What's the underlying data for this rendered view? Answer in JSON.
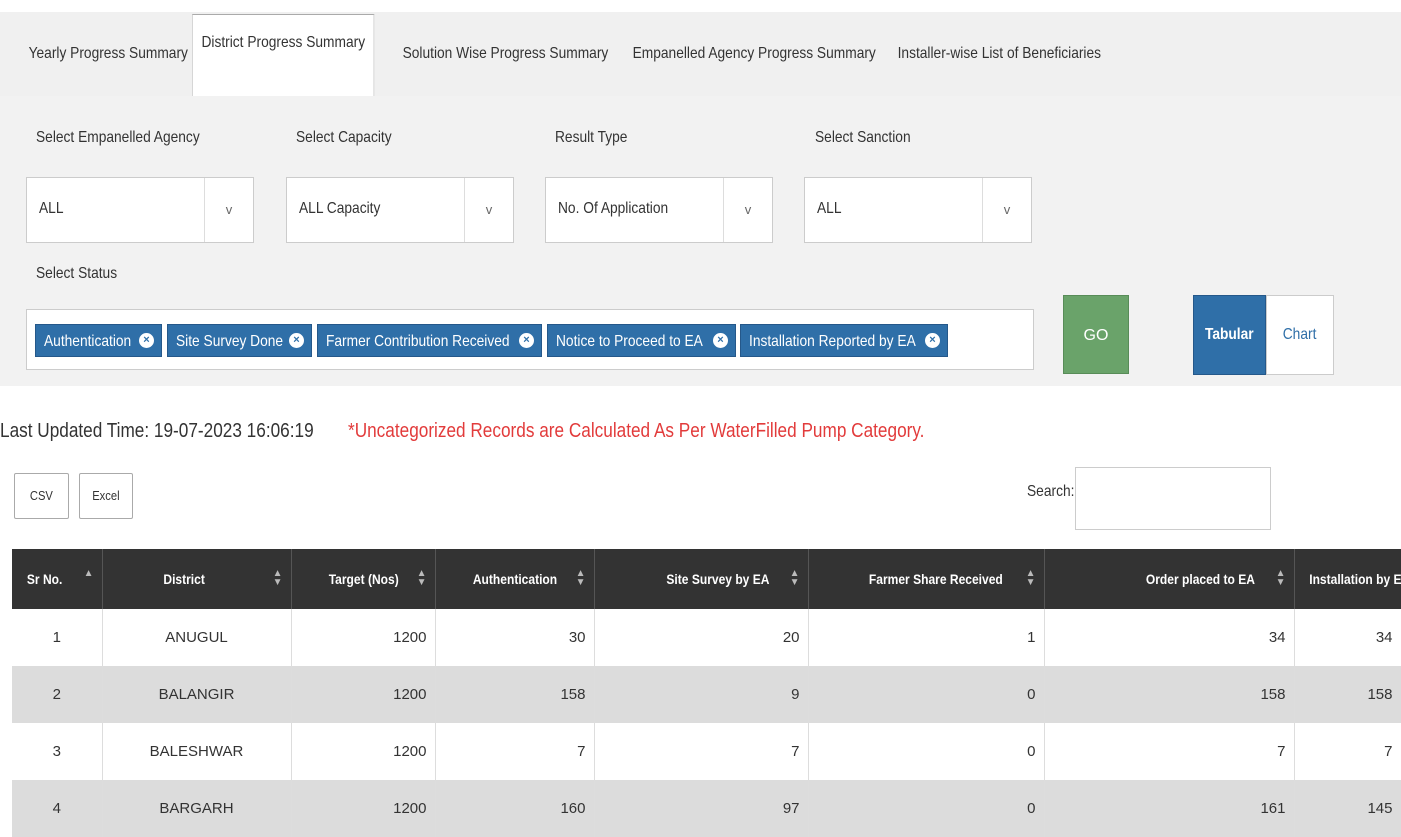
{
  "tabs": [
    {
      "label": "Yearly Progress Summary",
      "active": false
    },
    {
      "label": "District Progress Summary",
      "active": true
    },
    {
      "label": "Solution Wise Progress Summary",
      "active": false
    },
    {
      "label": "Empanelled Agency Progress Summary",
      "active": false
    },
    {
      "label": "Installer-wise List of Beneficiaries",
      "active": false
    }
  ],
  "filters": {
    "agency": {
      "label": "Select Empanelled Agency",
      "value": "ALL"
    },
    "capacity": {
      "label": "Select Capacity",
      "value": "ALL Capacity"
    },
    "result_type": {
      "label": "Result Type",
      "value": "No. Of Application"
    },
    "sanction": {
      "label": "Select Sanction",
      "value": "ALL"
    },
    "status": {
      "label": "Select Status",
      "chips": [
        "Authentication",
        "Site Survey Done",
        "Farmer Contribution Received",
        "Notice to Proceed to EA",
        "Installation Reported by EA"
      ]
    }
  },
  "actions": {
    "go_label": "GO",
    "tabular_label": "Tabular",
    "chart_label": "Chart"
  },
  "info": {
    "last_updated": "Last Updated Time: 19-07-2023 16:06:19",
    "note": "*Uncategorized Records are Calculated As Per WaterFilled Pump Category."
  },
  "toolbar": {
    "csv_label": "CSV",
    "excel_label": "Excel",
    "search_label": "Search:",
    "search_value": ""
  },
  "table": {
    "columns": [
      "Sr No.",
      "District",
      "Target (Nos)",
      "Authentication",
      "Site Survey by EA",
      "Farmer Share Received",
      "Order placed to EA",
      "Installation by EA"
    ],
    "rows": [
      [
        "1",
        "ANUGUL",
        "1200",
        "30",
        "20",
        "1",
        "34",
        "34"
      ],
      [
        "2",
        "BALANGIR",
        "1200",
        "158",
        "9",
        "0",
        "158",
        "158"
      ],
      [
        "3",
        "BALESHWAR",
        "1200",
        "7",
        "7",
        "0",
        "7",
        "7"
      ],
      [
        "4",
        "BARGARH",
        "1200",
        "160",
        "97",
        "0",
        "161",
        "145"
      ]
    ]
  },
  "colors": {
    "primary": "#2f6fa8",
    "go": "#6aa36a",
    "note": "#e23b3b",
    "header": "#333333"
  },
  "icons": {
    "dropdown": "chevron-down-icon",
    "chip_remove": "close-circle-icon",
    "sort": "sort-icon"
  }
}
